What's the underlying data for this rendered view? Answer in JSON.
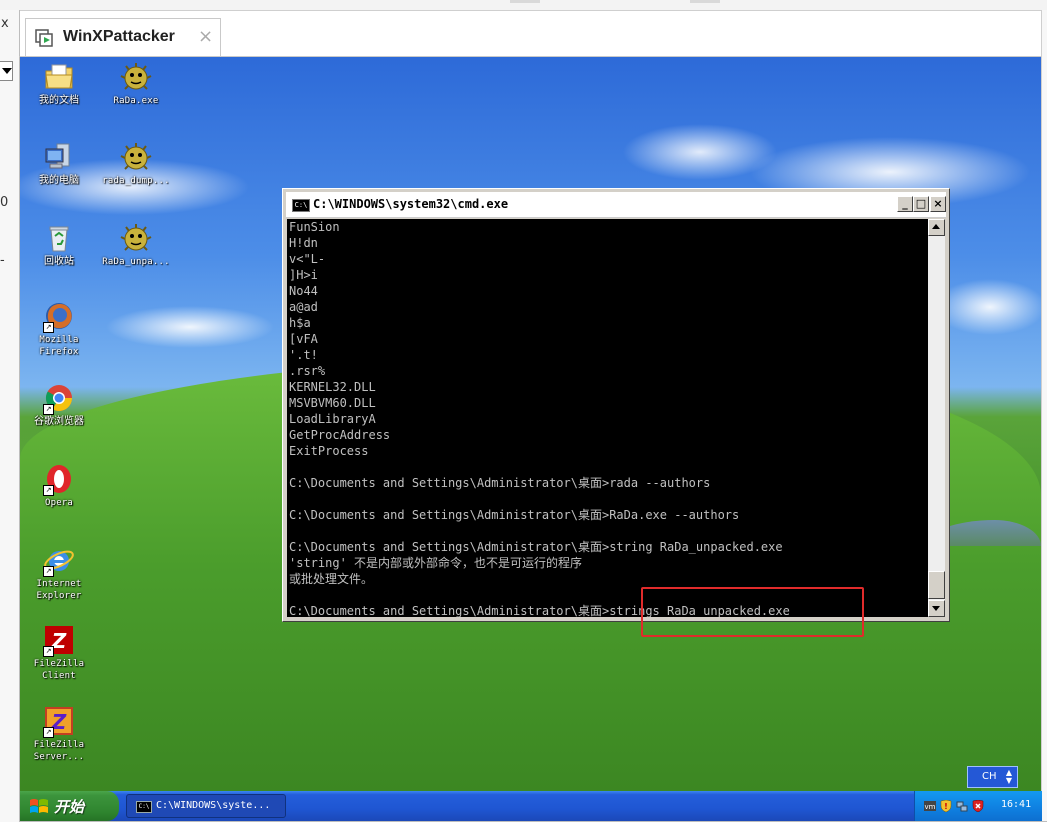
{
  "host": {
    "tab_title": "WinXPattacker",
    "tab_close": "×",
    "left_close": "x",
    "left_fragment_a": "0",
    "left_fragment_b": "-"
  },
  "desktop_icons": [
    {
      "name": "my-documents-icon",
      "label": "我的文档"
    },
    {
      "name": "rada-exe-icon",
      "label": "RaDa.exe"
    },
    {
      "name": "my-computer-icon",
      "label": "我的电脑"
    },
    {
      "name": "rada-dump-icon",
      "label": "rada_dump..."
    },
    {
      "name": "recycle-bin-icon",
      "label": "回收站"
    },
    {
      "name": "rada-unpacked-icon",
      "label": "RaDa_unpa..."
    },
    {
      "name": "firefox-icon",
      "label": "Mozilla\nFirefox"
    },
    {
      "name": "chrome-icon",
      "label": "谷歌浏览器"
    },
    {
      "name": "opera-icon",
      "label": "Opera"
    },
    {
      "name": "ie-icon",
      "label": "Internet\nExplorer"
    },
    {
      "name": "filezilla-client-icon",
      "label": "FileZilla\nClient"
    },
    {
      "name": "filezilla-server-icon",
      "label": "FileZilla\nServer..."
    }
  ],
  "cmd": {
    "title": "C:\\WINDOWS\\system32\\cmd.exe",
    "icon_text": "C:\\",
    "lines": [
      "FunSion",
      "H!dn",
      "v<\"L-",
      "]H>i",
      "No44",
      "a@ad",
      "h$a",
      "[vFA",
      "'.t!",
      ".rsr%",
      "KERNEL32.DLL",
      "MSVBVM60.DLL",
      "LoadLibraryA",
      "GetProcAddress",
      "ExitProcess",
      "",
      "C:\\Documents and Settings\\Administrator\\桌面>rada --authors",
      "",
      "C:\\Documents and Settings\\Administrator\\桌面>RaDa.exe --authors",
      "",
      "C:\\Documents and Settings\\Administrator\\桌面>string RaDa_unpacked.exe",
      "'string' 不是内部或外部命令，也不是可运行的程序",
      "或批处理文件。",
      "",
      "C:\\Documents and Settings\\Administrator\\桌面>strings RaDa_unpacked.exe"
    ],
    "min_label": "_",
    "max_label": "□",
    "close_label": "×"
  },
  "taskbar": {
    "start_label": "开始",
    "task_label": "C:\\WINDOWS\\syste...",
    "task_icon_text": "C:\\",
    "clock": "16:41",
    "ime_label": "CH"
  },
  "colors": {
    "highlight_box": "#e02b2b",
    "taskbar": "#245edb",
    "start": "#3c943c"
  }
}
